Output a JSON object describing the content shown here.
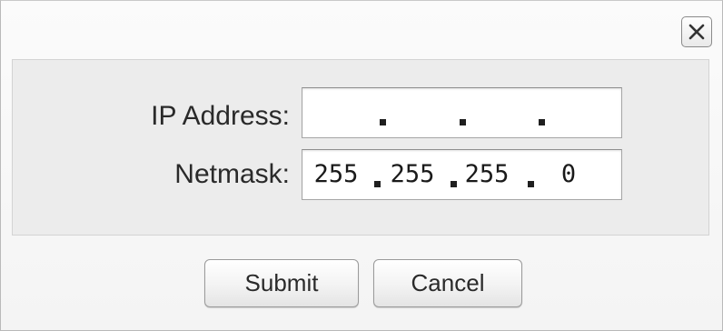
{
  "dialog": {
    "close_icon": "close-icon"
  },
  "form": {
    "ip_label": "IP Address:",
    "ip_octets": [
      "",
      "",
      "",
      ""
    ],
    "netmask_label": "Netmask:",
    "netmask_octets": [
      "255",
      "255",
      "255",
      "0"
    ]
  },
  "buttons": {
    "submit": "Submit",
    "cancel": "Cancel"
  }
}
